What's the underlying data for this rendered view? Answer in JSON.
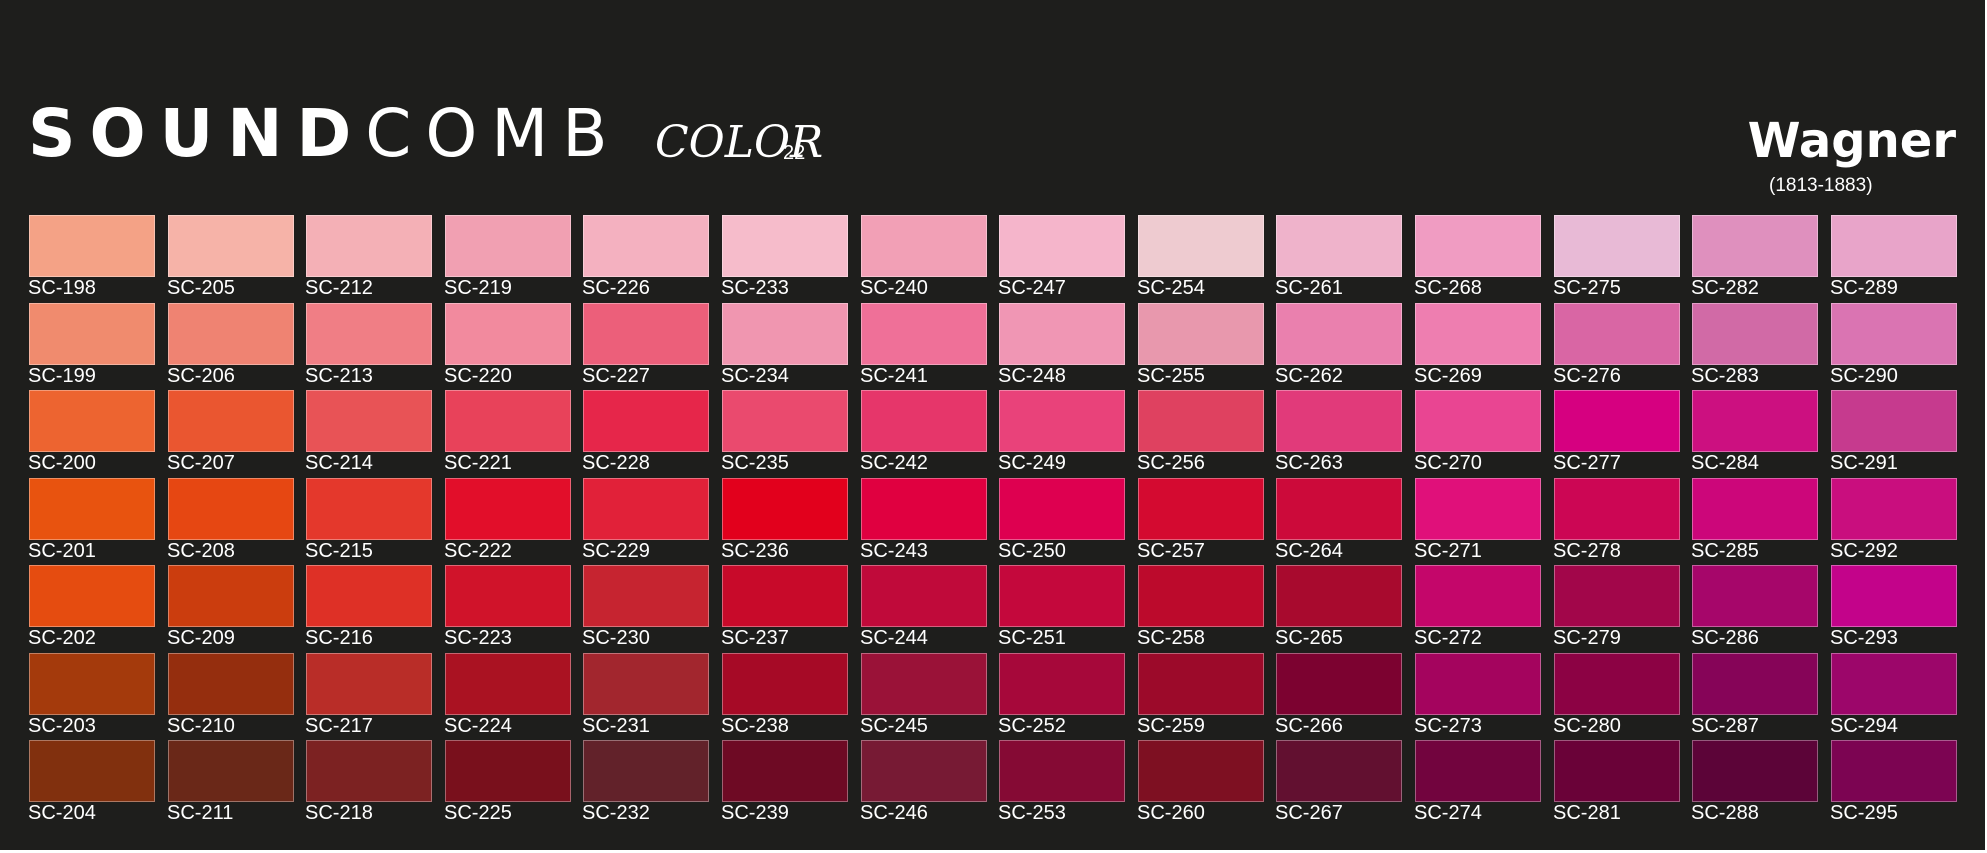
{
  "header": {
    "brand_bold": "SOUND",
    "brand_light": "COMB",
    "color_label": "COLOR",
    "color_number": "22",
    "artist": "Wagner",
    "years": "(1813-1883)"
  },
  "swatches": [
    {
      "code": "SC-198",
      "color": "#f4a286"
    },
    {
      "code": "SC-205",
      "color": "#f6b3a8"
    },
    {
      "code": "SC-212",
      "color": "#f4b0b6"
    },
    {
      "code": "SC-219",
      "color": "#f1a0b2"
    },
    {
      "code": "SC-226",
      "color": "#f4b1c0"
    },
    {
      "code": "SC-233",
      "color": "#f6bccb"
    },
    {
      "code": "SC-240",
      "color": "#f2a0b6"
    },
    {
      "code": "SC-247",
      "color": "#f5b5cb"
    },
    {
      "code": "SC-254",
      "color": "#eecbd0"
    },
    {
      "code": "SC-261",
      "color": "#efb3cb"
    },
    {
      "code": "SC-268",
      "color": "#f09cc2"
    },
    {
      "code": "SC-275",
      "color": "#e8bad6"
    },
    {
      "code": "SC-282",
      "color": "#df90be"
    },
    {
      "code": "SC-289",
      "color": "#e8a4c9"
    },
    {
      "code": "SC-199",
      "color": "#f08b6e"
    },
    {
      "code": "SC-206",
      "color": "#ef8372"
    },
    {
      "code": "SC-213",
      "color": "#f07e85"
    },
    {
      "code": "SC-220",
      "color": "#f28a9e"
    },
    {
      "code": "SC-227",
      "color": "#ec5f7a"
    },
    {
      "code": "SC-234",
      "color": "#f096b0"
    },
    {
      "code": "SC-241",
      "color": "#ef7098"
    },
    {
      "code": "SC-248",
      "color": "#f096b4"
    },
    {
      "code": "SC-255",
      "color": "#e898ad"
    },
    {
      "code": "SC-262",
      "color": "#ea80ae"
    },
    {
      "code": "SC-269",
      "color": "#ee7eb0"
    },
    {
      "code": "SC-276",
      "color": "#d966a4"
    },
    {
      "code": "SC-283",
      "color": "#d16aa6"
    },
    {
      "code": "SC-290",
      "color": "#da74b2"
    },
    {
      "code": "SC-200",
      "color": "#ed6430"
    },
    {
      "code": "SC-207",
      "color": "#ea5630"
    },
    {
      "code": "SC-214",
      "color": "#e85356"
    },
    {
      "code": "SC-221",
      "color": "#e8425a"
    },
    {
      "code": "SC-228",
      "color": "#e6264a"
    },
    {
      "code": "SC-235",
      "color": "#ea4a6e"
    },
    {
      "code": "SC-242",
      "color": "#e6366a"
    },
    {
      "code": "SC-249",
      "color": "#e9427a"
    },
    {
      "code": "SC-256",
      "color": "#df4160"
    },
    {
      "code": "SC-263",
      "color": "#e13a7a"
    },
    {
      "code": "SC-270",
      "color": "#e94592"
    },
    {
      "code": "SC-277",
      "color": "#d60080"
    },
    {
      "code": "SC-284",
      "color": "#cc1080"
    },
    {
      "code": "SC-291",
      "color": "#c63a8e"
    },
    {
      "code": "SC-201",
      "color": "#e8530f"
    },
    {
      "code": "SC-208",
      "color": "#e64712"
    },
    {
      "code": "SC-215",
      "color": "#e4382c"
    },
    {
      "code": "SC-222",
      "color": "#e20e2a"
    },
    {
      "code": "SC-229",
      "color": "#e12139"
    },
    {
      "code": "SC-236",
      "color": "#e2001c"
    },
    {
      "code": "SC-243",
      "color": "#e00040"
    },
    {
      "code": "SC-250",
      "color": "#de0050"
    },
    {
      "code": "SC-257",
      "color": "#d40a30"
    },
    {
      "code": "SC-264",
      "color": "#cc0a3a"
    },
    {
      "code": "SC-271",
      "color": "#e0107a"
    },
    {
      "code": "SC-278",
      "color": "#cc0654"
    },
    {
      "code": "SC-285",
      "color": "#cc067a"
    },
    {
      "code": "SC-292",
      "color": "#c90e7e"
    },
    {
      "code": "SC-202",
      "color": "#e54c10"
    },
    {
      "code": "SC-209",
      "color": "#cb3d0e"
    },
    {
      "code": "SC-216",
      "color": "#de3026"
    },
    {
      "code": "SC-223",
      "color": "#d0132a"
    },
    {
      "code": "SC-230",
      "color": "#c62430"
    },
    {
      "code": "SC-237",
      "color": "#c80a2a"
    },
    {
      "code": "SC-244",
      "color": "#c00a3a"
    },
    {
      "code": "SC-251",
      "color": "#c4083c"
    },
    {
      "code": "SC-258",
      "color": "#bc0a2c"
    },
    {
      "code": "SC-265",
      "color": "#a80a2e"
    },
    {
      "code": "SC-272",
      "color": "#c4066a"
    },
    {
      "code": "SC-279",
      "color": "#a2064a"
    },
    {
      "code": "SC-286",
      "color": "#a6066a"
    },
    {
      "code": "SC-293",
      "color": "#c3038a"
    },
    {
      "code": "SC-203",
      "color": "#a43a0c"
    },
    {
      "code": "SC-210",
      "color": "#952e0e"
    },
    {
      "code": "SC-217",
      "color": "#b92d28"
    },
    {
      "code": "SC-224",
      "color": "#aa1222"
    },
    {
      "code": "SC-231",
      "color": "#a2262e"
    },
    {
      "code": "SC-238",
      "color": "#a60a26"
    },
    {
      "code": "SC-245",
      "color": "#9a1238"
    },
    {
      "code": "SC-252",
      "color": "#a6083a"
    },
    {
      "code": "SC-259",
      "color": "#9c0a2a"
    },
    {
      "code": "SC-266",
      "color": "#7c0230"
    },
    {
      "code": "SC-273",
      "color": "#a4045e"
    },
    {
      "code": "SC-280",
      "color": "#8c0244"
    },
    {
      "code": "SC-287",
      "color": "#860458"
    },
    {
      "code": "SC-294",
      "color": "#9c066a"
    },
    {
      "code": "SC-204",
      "color": "#81300e"
    },
    {
      "code": "SC-211",
      "color": "#6a2818"
    },
    {
      "code": "SC-218",
      "color": "#7c2222"
    },
    {
      "code": "SC-225",
      "color": "#79101c"
    },
    {
      "code": "SC-232",
      "color": "#62222a"
    },
    {
      "code": "SC-239",
      "color": "#6e0a24"
    },
    {
      "code": "SC-246",
      "color": "#771a34"
    },
    {
      "code": "SC-253",
      "color": "#850a34"
    },
    {
      "code": "SC-260",
      "color": "#7e1022"
    },
    {
      "code": "SC-267",
      "color": "#621030"
    },
    {
      "code": "SC-274",
      "color": "#72043e"
    },
    {
      "code": "SC-281",
      "color": "#6a0238"
    },
    {
      "code": "SC-288",
      "color": "#5c0438"
    },
    {
      "code": "SC-295",
      "color": "#7c0452"
    }
  ]
}
